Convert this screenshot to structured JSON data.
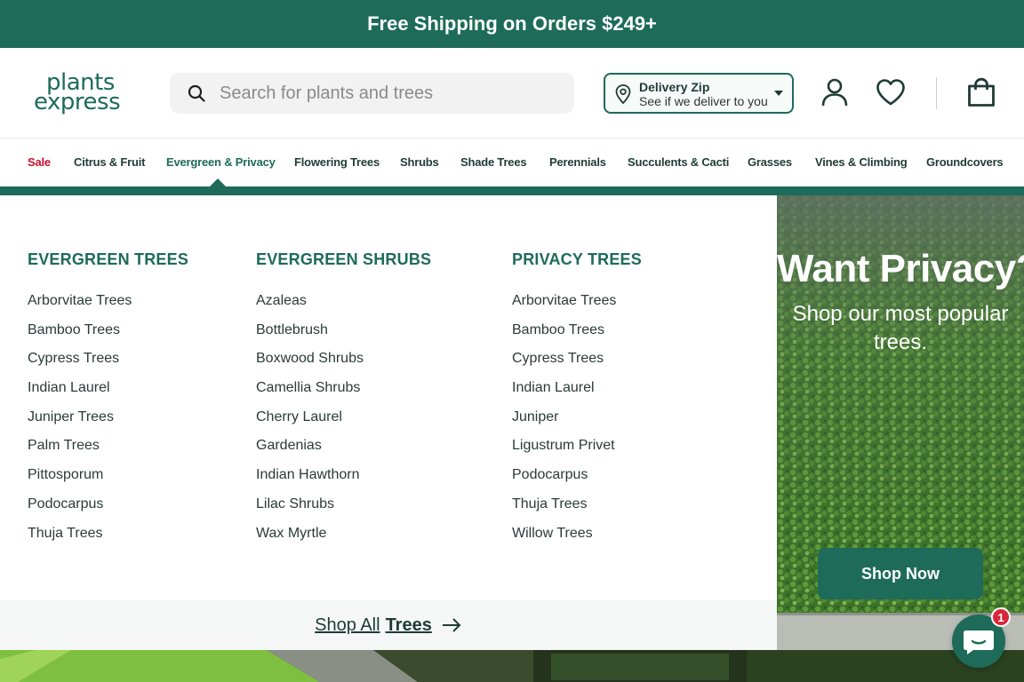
{
  "announcement": {
    "text": "Free Shipping on Orders $249+"
  },
  "header": {
    "logo_line1": "plants",
    "logo_line2": "express",
    "search_placeholder": "Search for plants and trees",
    "delivery_title": "Delivery Zip",
    "delivery_subtitle": "See if we deliver to you",
    "icons": [
      "search-icon",
      "location-pin-icon",
      "chevron-down-icon",
      "account-icon",
      "heart-icon",
      "shopping-bag-icon"
    ]
  },
  "nav": {
    "items": [
      {
        "label": "Sale"
      },
      {
        "label": "Citrus & Fruit"
      },
      {
        "label": "Evergreen & Privacy"
      },
      {
        "label": "Flowering Trees"
      },
      {
        "label": "Shrubs"
      },
      {
        "label": "Shade Trees"
      },
      {
        "label": "Perennials"
      },
      {
        "label": "Succulents & Cacti"
      },
      {
        "label": "Grasses"
      },
      {
        "label": "Vines & Climbing"
      },
      {
        "label": "Groundcovers"
      }
    ],
    "active": "Evergreen & Privacy"
  },
  "mega_menu": {
    "columns": [
      {
        "heading": "EVERGREEN TREES",
        "items": [
          "Arborvitae Trees",
          "Bamboo Trees",
          "Cypress Trees",
          "Indian Laurel",
          "Juniper Trees",
          "Palm Trees",
          "Pittosporum",
          "Podocarpus",
          "Thuja Trees"
        ]
      },
      {
        "heading": "EVERGREEN SHRUBS",
        "items": [
          "Azaleas",
          "Bottlebrush",
          "Boxwood Shrubs",
          "Camellia Shrubs",
          "Cherry Laurel",
          "Gardenias",
          "Indian Hawthorn",
          "Lilac Shrubs",
          "Wax Myrtle"
        ]
      },
      {
        "heading": "PRIVACY TREES",
        "items": [
          "Arborvitae Trees",
          "Bamboo Trees",
          "Cypress Trees",
          "Indian Laurel",
          "Juniper",
          "Ligustrum Privet",
          "Podocarpus",
          "Thuja Trees",
          "Willow Trees"
        ]
      }
    ],
    "shop_all_prefix": "Shop All",
    "shop_all_bold": "Trees"
  },
  "promo": {
    "title": "Want Privacy?",
    "subtitle": "Shop our most popular trees.",
    "button_label": "Shop Now"
  },
  "chat": {
    "badge_count": "1"
  },
  "colors": {
    "brand_green": "#1e6b5a",
    "sale_red": "#c8102e",
    "badge_red": "#d8263a"
  }
}
